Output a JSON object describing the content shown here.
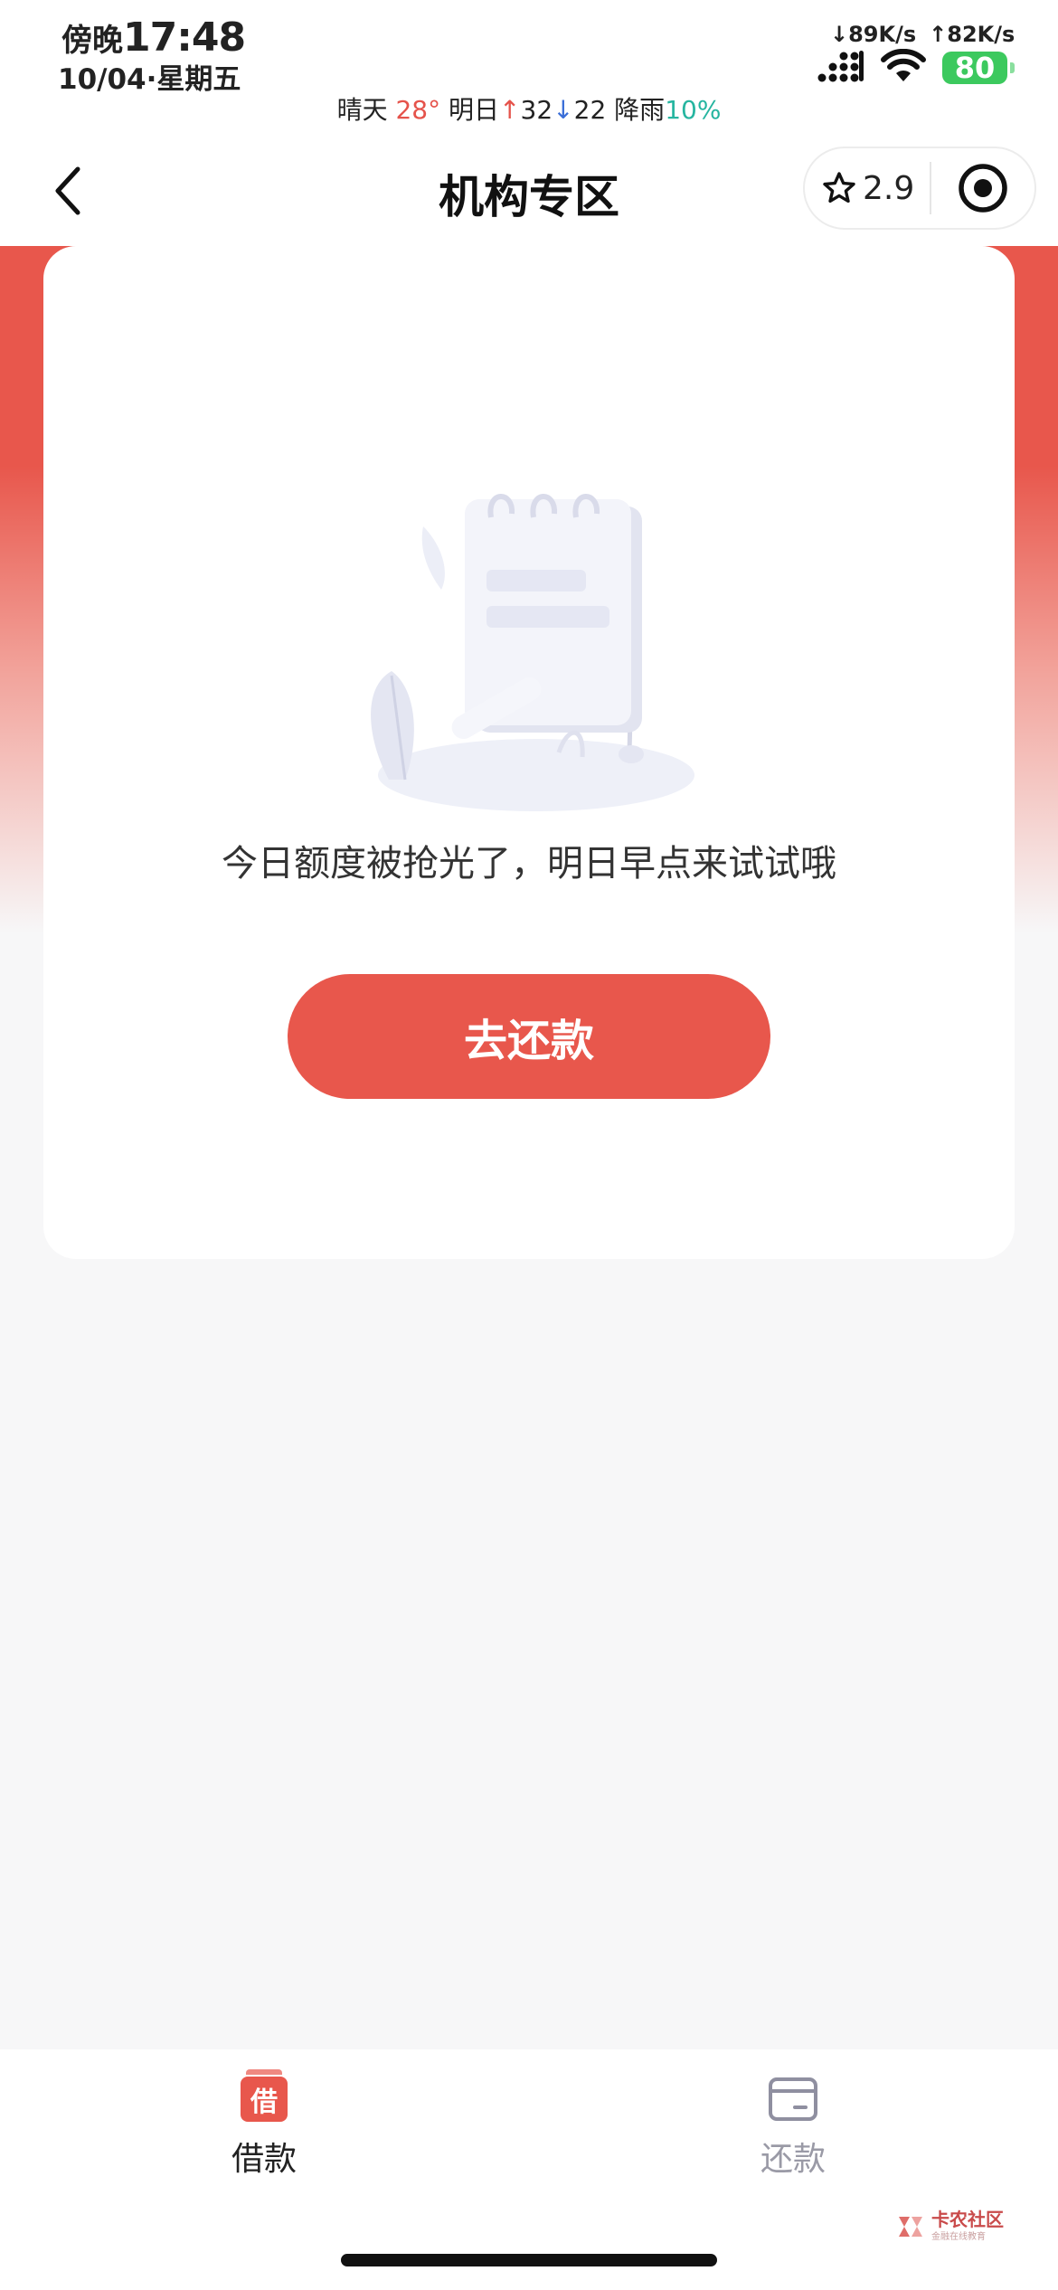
{
  "status_bar": {
    "period": "傍晚",
    "time": "17:48",
    "date": "10/04·星期五",
    "download_speed": "↓89K/s",
    "upload_speed": "↑82K/s",
    "battery": "80",
    "weather": {
      "condition": "晴天",
      "temperature": "28°",
      "tomorrow_label": "明日",
      "high_arrow": "↑",
      "high": "32",
      "low_arrow": "↓",
      "low": "22",
      "rain_label": "降雨",
      "rain_chance": "10%"
    }
  },
  "nav": {
    "title": "机构专区",
    "rating": "2.9",
    "back_icon": "chevron-left-icon",
    "rating_icon": "star-icon",
    "menu_icon": "target-icon"
  },
  "card": {
    "empty_message": "今日额度被抢光了，明日早点来试试哦",
    "button_label": "去还款"
  },
  "tabs": [
    {
      "label": "借款",
      "icon_text": "借",
      "active": true
    },
    {
      "label": "还款",
      "active": false
    }
  ],
  "watermark": {
    "name": "卡农社区",
    "sub": "金融在线教育"
  },
  "colors": {
    "accent": "#e8574c",
    "inactive": "#9a9aa6"
  }
}
